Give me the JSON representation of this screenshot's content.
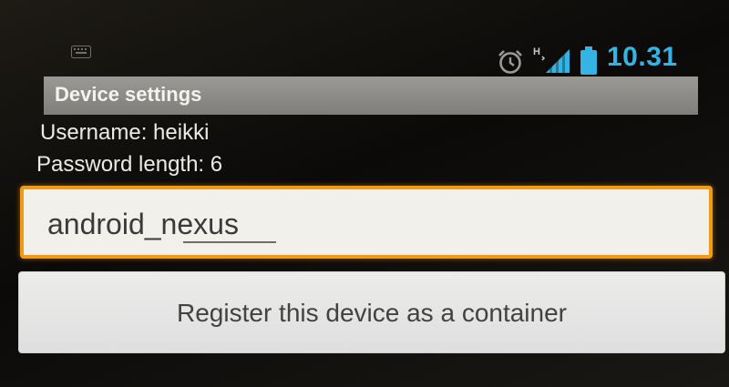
{
  "status_bar": {
    "time": "10.31",
    "accent_color": "#34b4e4",
    "icons": [
      "keyboard-icon",
      "alarm-icon",
      "signal-hspa-icon",
      "battery-icon"
    ],
    "network_label": "H"
  },
  "settings": {
    "header": "Device settings",
    "username_line": "Username: heikki",
    "password_line": "Password length: 6"
  },
  "device_field": {
    "value": "android_nexus",
    "focus_color": "#f39a12"
  },
  "register_button": {
    "label": "Register this device as a container"
  }
}
